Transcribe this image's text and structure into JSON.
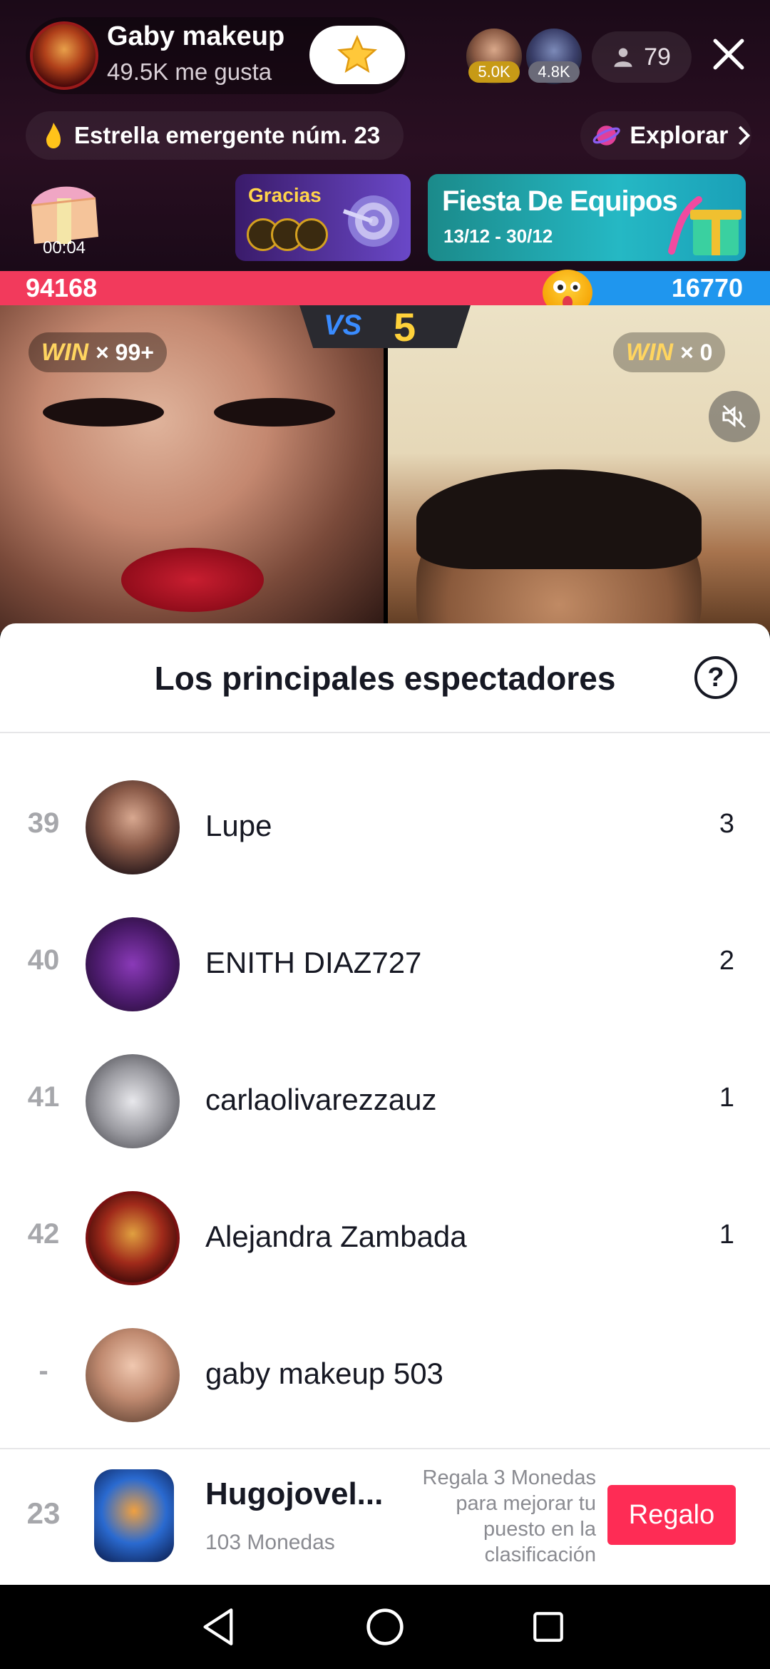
{
  "host": {
    "name": "Gaby makeup",
    "likes": "49.5K me gusta"
  },
  "top_viewers": [
    {
      "badge": "5.0K"
    },
    {
      "badge": "4.8K"
    }
  ],
  "viewer_count": "79",
  "rising_star": "Estrella emergente núm. 23",
  "explore_label": "Explorar",
  "treasure_timer": "00:04",
  "thanks_card": {
    "title": "Gracias"
  },
  "event_card": {
    "title": "Fiesta De Equipos",
    "dates": "13/12 - 30/12"
  },
  "battle": {
    "score_left": "94168",
    "score_right": "16770",
    "vs_label": "VS",
    "round_count": "5",
    "left_share": 0.85,
    "win_left_word": "WIN",
    "win_left": "× 99+",
    "win_right_word": "WIN",
    "win_right": "× 0"
  },
  "sheet": {
    "title": "Los principales espectadores",
    "help": "?"
  },
  "leaderboard": [
    {
      "rank": "39",
      "name": "Lupe",
      "coins": "3"
    },
    {
      "rank": "40",
      "name": "ENITH DIAZ727",
      "coins": "2"
    },
    {
      "rank": "41",
      "name": "carlaolivarezzauz",
      "coins": "1"
    },
    {
      "rank": "42",
      "name": "Alejandra Zambada",
      "coins": "1"
    },
    {
      "rank": "-",
      "name": "gaby makeup 503",
      "coins": ""
    }
  ],
  "me": {
    "rank": "23",
    "name": "Hugojovel...",
    "coins": "103 Monedas",
    "hint": "Regala 3 Monedas para mejorar tu puesto en la clasificación",
    "gift_label": "Regalo"
  },
  "colors": {
    "accent": "#fe2c55",
    "battle_red": "#f23a5c",
    "battle_blue": "#1f96ee",
    "win_gold": "#ffd560"
  },
  "icons": [
    "star-icon",
    "person-icon",
    "close-icon",
    "flame-icon",
    "planet-icon",
    "chevron-right-icon",
    "treasure-chest-icon",
    "target-icon",
    "mute-icon",
    "help-icon",
    "back-icon",
    "home-icon",
    "recents-icon"
  ]
}
